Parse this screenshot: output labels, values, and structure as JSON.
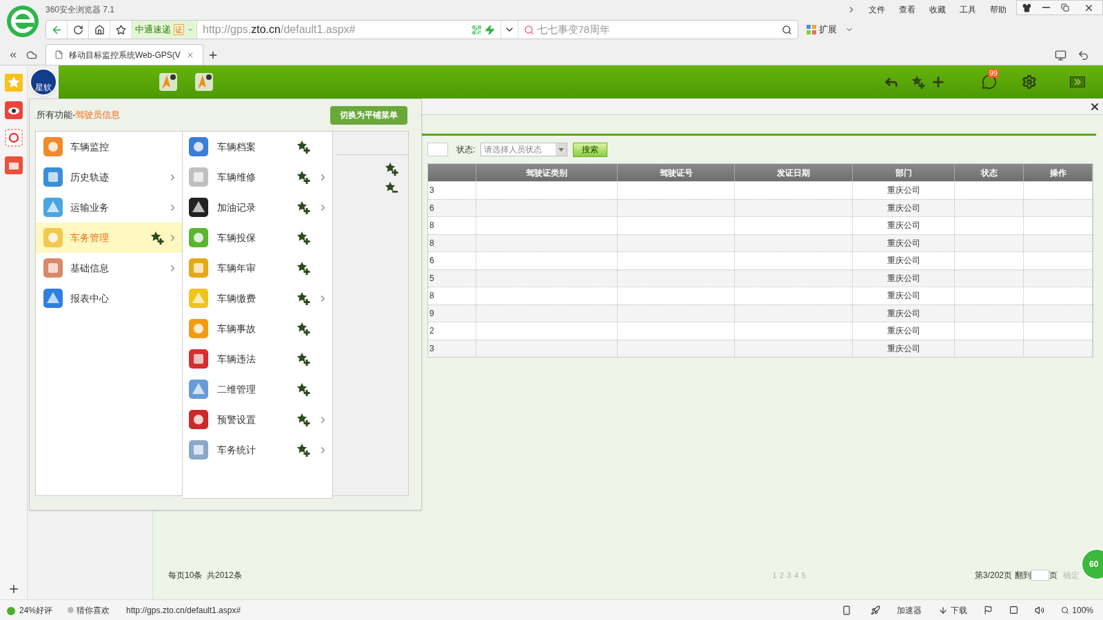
{
  "browser": {
    "title": "360安全浏览器 7.1",
    "menu": [
      "文件",
      "查看",
      "收藏",
      "工具",
      "帮助"
    ],
    "site_name": "中通速递",
    "cert_badge": "证",
    "url": {
      "scheme": "http://gps.",
      "domain": "zto.cn",
      "path": "/default1.aspx#"
    },
    "search": {
      "placeholder": "七七事变78周年"
    },
    "extensions": "扩展",
    "tab": {
      "title": "移动目标监控系统Web-GPS(V"
    }
  },
  "app_header": {
    "logo_text": "星软",
    "badge": "99"
  },
  "menu": {
    "title": "所有功能-",
    "current": "驾驶员信息",
    "switch_button": "切换为平铺菜单",
    "categories": [
      {
        "label": "车辆监控",
        "arrow": false,
        "selected": false
      },
      {
        "label": "历史轨迹",
        "arrow": true,
        "selected": false
      },
      {
        "label": "运输业务",
        "arrow": true,
        "selected": false
      },
      {
        "label": "车务管理",
        "arrow": true,
        "selected": true
      },
      {
        "label": "基础信息",
        "arrow": true,
        "selected": false
      },
      {
        "label": "报表中心",
        "arrow": false,
        "selected": false
      }
    ],
    "items": [
      {
        "label": "车辆档案",
        "arrow": false
      },
      {
        "label": "车辆维修",
        "arrow": true
      },
      {
        "label": "加油记录",
        "arrow": true
      },
      {
        "label": "车辆投保",
        "arrow": false
      },
      {
        "label": "车辆年审",
        "arrow": false
      },
      {
        "label": "车辆缴费",
        "arrow": true
      },
      {
        "label": "车辆事故",
        "arrow": false
      },
      {
        "label": "车辆违法",
        "arrow": false
      },
      {
        "label": "二维管理",
        "arrow": false
      },
      {
        "label": "预警设置",
        "arrow": true
      },
      {
        "label": "车务统计",
        "arrow": true
      }
    ]
  },
  "filter": {
    "status_label": "状态:",
    "status_placeholder": "请选择人员状态",
    "search_button": "搜索"
  },
  "table": {
    "columns": [
      "驾驶证类别",
      "驾驶证号",
      "发证日期",
      "部门",
      "状态",
      "操作"
    ],
    "rows": [
      {
        "column_1": "3",
        "department": "重庆公司"
      },
      {
        "column_1": "6",
        "department": "重庆公司"
      },
      {
        "column_1": "8",
        "department": "重庆公司"
      },
      {
        "column_1": "8",
        "department": "重庆公司"
      },
      {
        "column_1": "6",
        "department": "重庆公司"
      },
      {
        "column_1": "5",
        "department": "重庆公司"
      },
      {
        "column_1": "8",
        "department": "重庆公司"
      },
      {
        "column_1": "9",
        "department": "重庆公司"
      },
      {
        "column_1": "2",
        "department": "重庆公司"
      },
      {
        "column_1": "3",
        "department": "重庆公司"
      }
    ]
  },
  "pagination": {
    "summary": "每页10条  共2012条",
    "pages": [
      "1",
      "2",
      "3",
      "4",
      "5"
    ],
    "position": "第3/202页",
    "goto_label": "翻到",
    "page_unit": "页",
    "confirm": "确定",
    "confirm_disabled": true
  },
  "float_badge": "60",
  "status_bar": {
    "rating": "24%好评",
    "guess": "猜你喜欢",
    "url": "http://gps.zto.cn/default1.aspx#",
    "accelerator": "加速器",
    "download": "下载",
    "zoom": "100%"
  }
}
